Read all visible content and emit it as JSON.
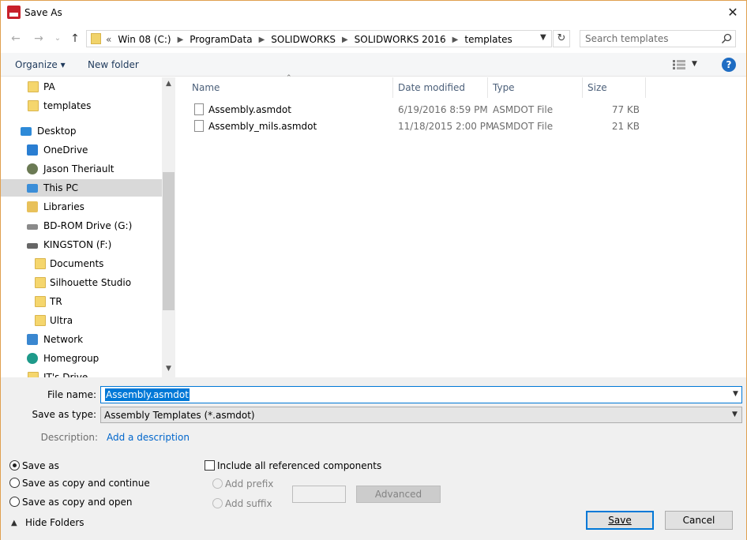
{
  "window": {
    "title": "Save As",
    "close_glyph": "✕",
    "app_icon": "solidworks-2016-icon"
  },
  "nav": {
    "back": "←",
    "forward": "→",
    "recent": "⌄",
    "up": "↑",
    "overflow": "«",
    "breadcrumbs": [
      "Win 08 (C:)",
      "ProgramData",
      "SOLIDWORKS",
      "SOLIDWORKS 2016",
      "templates"
    ],
    "refresh_glyph": "↻"
  },
  "search": {
    "placeholder": "Search templates"
  },
  "toolbar": {
    "organize": "Organize ▾",
    "new_folder": "New folder",
    "help": "?"
  },
  "navpane": {
    "items": [
      {
        "label": "PA",
        "icon": "folder-icon",
        "indent": 1
      },
      {
        "label": "templates",
        "icon": "folder-icon",
        "indent": 1
      },
      {
        "label": "Desktop",
        "icon": "desktop-icon",
        "indent": 0
      },
      {
        "label": "OneDrive",
        "icon": "onedrive-icon",
        "indent": 0
      },
      {
        "label": "Jason Theriault",
        "icon": "user-icon",
        "indent": 0
      },
      {
        "label": "This PC",
        "icon": "this-pc-icon",
        "indent": 0,
        "selected": true
      },
      {
        "label": "Libraries",
        "icon": "libraries-icon",
        "indent": 0
      },
      {
        "label": "BD-ROM Drive (G:)",
        "icon": "optical-drive-icon",
        "indent": 0
      },
      {
        "label": "KINGSTON (F:)",
        "icon": "usb-drive-icon",
        "indent": 0
      },
      {
        "label": "Documents",
        "icon": "folder-icon",
        "indent": 2
      },
      {
        "label": "Silhouette Studio",
        "icon": "folder-icon",
        "indent": 2
      },
      {
        "label": "TR",
        "icon": "folder-icon",
        "indent": 2
      },
      {
        "label": "Ultra",
        "icon": "folder-icon",
        "indent": 2
      },
      {
        "label": "Network",
        "icon": "network-icon",
        "indent": 0
      },
      {
        "label": "Homegroup",
        "icon": "homegroup-icon",
        "indent": 0
      },
      {
        "label": "JT's Drive",
        "icon": "folder-icon",
        "indent": 1
      }
    ]
  },
  "filelist": {
    "columns": [
      "Name",
      "Date modified",
      "Type",
      "Size"
    ],
    "rows": [
      {
        "name": "Assembly.asmdot",
        "date": "6/19/2016 8:59 PM",
        "type": "ASMDOT File",
        "size": "77 KB"
      },
      {
        "name": "Assembly_mils.asmdot",
        "date": "11/18/2015 2:00 PM",
        "type": "ASMDOT File",
        "size": "21 KB"
      }
    ]
  },
  "form": {
    "file_name_label": "File name:",
    "file_name_value": "Assembly.asmdot",
    "save_type_label": "Save as type:",
    "save_type_value": "Assembly Templates (*.asmdot)",
    "description_label": "Description:",
    "description_link": "Add a description"
  },
  "options": {
    "save_as": "Save as",
    "save_copy_continue": "Save as copy and continue",
    "save_copy_open": "Save as copy and open",
    "include_refs": "Include all referenced components",
    "add_prefix": "Add prefix",
    "add_suffix": "Add suffix",
    "advanced": "Advanced",
    "selected_mode": "save_as"
  },
  "footer": {
    "hide_folders": "Hide Folders",
    "save": "Save",
    "cancel": "Cancel"
  },
  "colors": {
    "accent": "#0078d7",
    "link": "#0066cc",
    "selected_nav": "#d9d9d9",
    "header_text": "#4c607a"
  }
}
